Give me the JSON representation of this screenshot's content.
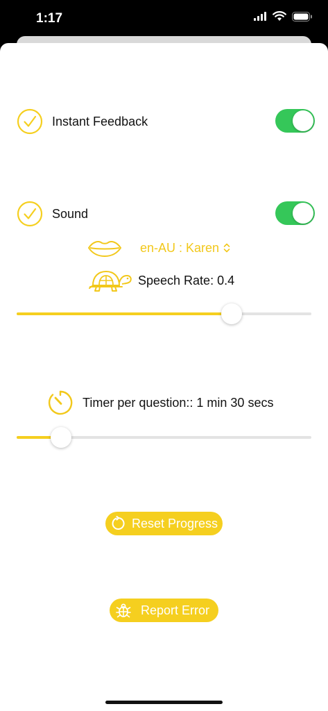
{
  "status_bar": {
    "time": "1:17"
  },
  "settings": {
    "instant_feedback": {
      "label": "Instant Feedback",
      "enabled": true
    },
    "sound": {
      "label": "Sound",
      "enabled": true
    },
    "voice": {
      "selected": "en-AU : Karen"
    },
    "speech_rate": {
      "label": "Speech Rate: 0.4",
      "slider_value": 0.73
    },
    "timer": {
      "label": "Timer per question:: 1 min 30 secs",
      "slider_value": 0.15
    }
  },
  "actions": {
    "reset_label": "Reset Progress",
    "report_label": "Report Error"
  },
  "colors": {
    "accent": "#f5cf1f",
    "toggle_on": "#35c759"
  },
  "icons": [
    "wifi-icon",
    "battery-icon",
    "check-circle-icon",
    "lips-icon",
    "chevron-updown-icon",
    "turtle-icon",
    "timer-icon",
    "reset-icon",
    "bug-icon"
  ]
}
